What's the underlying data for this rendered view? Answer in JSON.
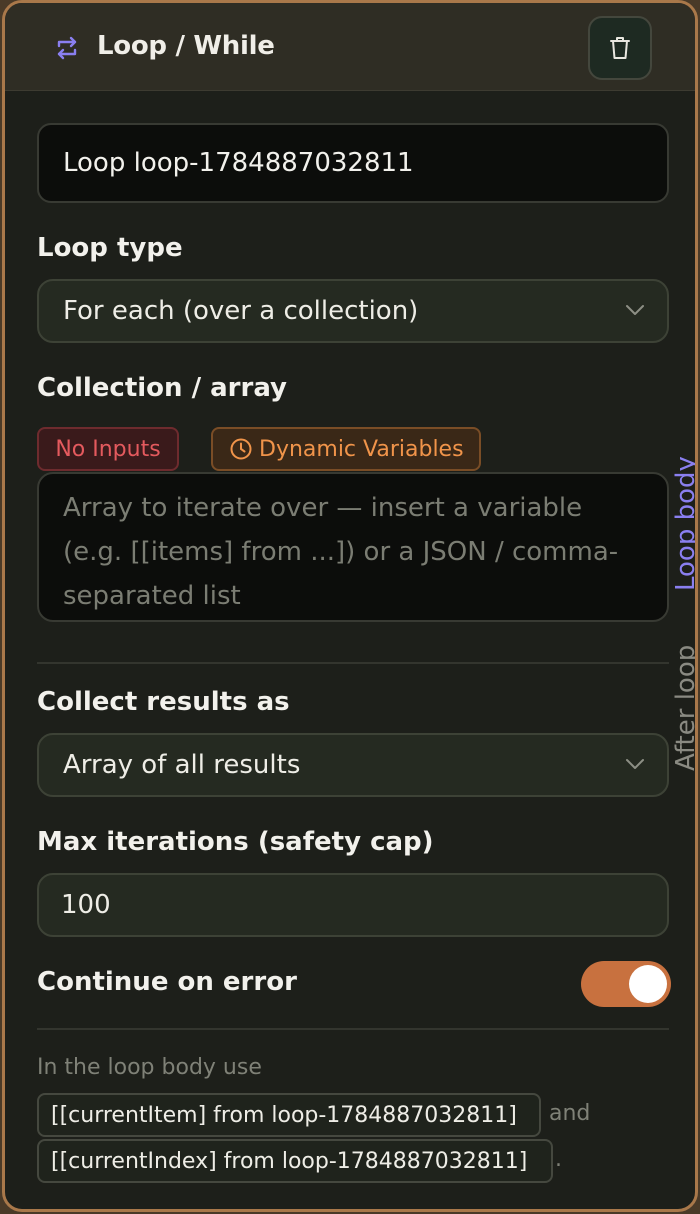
{
  "header": {
    "title": "Loop / While",
    "icon": "loop-arrows-icon",
    "delete_icon": "trash-icon"
  },
  "node_name": {
    "value": "Loop loop-1784887032811"
  },
  "loop_type": {
    "label": "Loop type",
    "value": "For each (over a collection)"
  },
  "collection": {
    "label": "Collection / array",
    "badge_no_inputs": "No Inputs",
    "badge_dynamic": "Dynamic Variables",
    "placeholder": "Array to iterate over — insert a variable (e.g. [[items] from ...]) or a JSON / comma-separated list"
  },
  "side_tabs": {
    "loop_body": "Loop body",
    "after_loop": "After loop"
  },
  "collect_results": {
    "label": "Collect results as",
    "value": "Array of all results"
  },
  "max_iterations": {
    "label": "Max iterations (safety cap)",
    "value": "100"
  },
  "continue_on_error": {
    "label": "Continue on error",
    "enabled": true
  },
  "hint": {
    "intro": "In the loop body use",
    "current_item": "[[currentItem] from loop-1784887032811]",
    "and": "and",
    "current_index": "[[currentIndex] from loop-1784887032811]",
    "end": "."
  },
  "colors": {
    "accent_purple": "#8a7ff0",
    "toggle_on": "#c8713f",
    "badge_red": "#e45a5e",
    "badge_orange": "#f0944a",
    "frame_border": "#a9784a"
  }
}
